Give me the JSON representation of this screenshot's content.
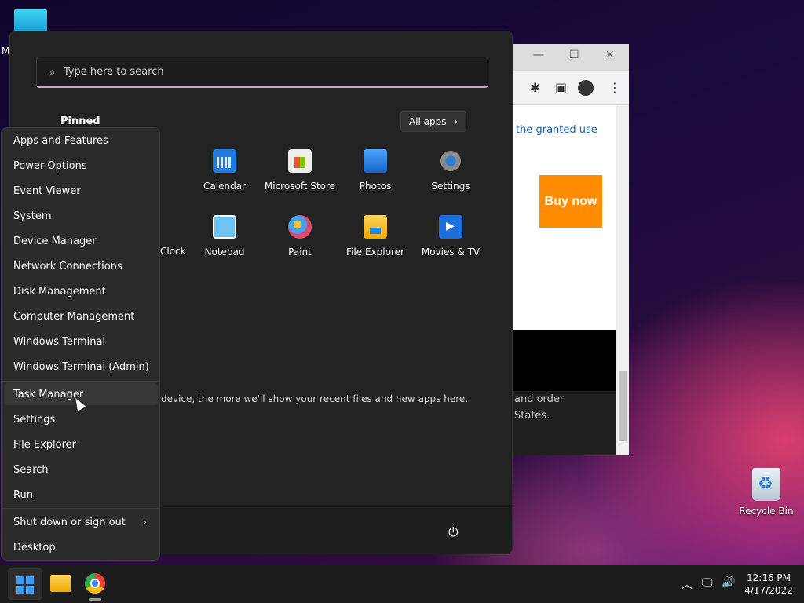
{
  "desktop": {
    "fragment_text": "M",
    "recycle_bin_label": "Recycle Bin"
  },
  "browser": {
    "granted_text": "the granted use",
    "buy_button": "Buy now",
    "footer_line1": "and order",
    "footer_line2": "States."
  },
  "start_menu": {
    "search_placeholder": "Type here to search",
    "pinned_title": "Pinned",
    "all_apps_label": "All apps",
    "apps": [
      {
        "label": "Calendar",
        "icon": "calendar-icon"
      },
      {
        "label": "Microsoft Store",
        "icon": "store-icon"
      },
      {
        "label": "Photos",
        "icon": "photos-icon"
      },
      {
        "label": "Settings",
        "icon": "settings-icon"
      },
      {
        "label": "Notepad",
        "icon": "notepad-icon"
      },
      {
        "label": "Paint",
        "icon": "paint-icon"
      },
      {
        "label": "File Explorer",
        "icon": "folder-icon"
      },
      {
        "label": "Movies & TV",
        "icon": "movies-icon"
      }
    ],
    "clock_fragment": "Clock",
    "recommended_text": "device, the more we'll show your recent files and new apps here."
  },
  "context_menu": {
    "items": [
      "Apps and Features",
      "Power Options",
      "Event Viewer",
      "System",
      "Device Manager",
      "Network Connections",
      "Disk Management",
      "Computer Management",
      "Windows Terminal",
      "Windows Terminal (Admin)",
      "Task Manager",
      "Settings",
      "File Explorer",
      "Search",
      "Run",
      "Shut down or sign out",
      "Desktop"
    ]
  },
  "taskbar": {
    "time": "12:16 PM",
    "date": "4/17/2022"
  }
}
